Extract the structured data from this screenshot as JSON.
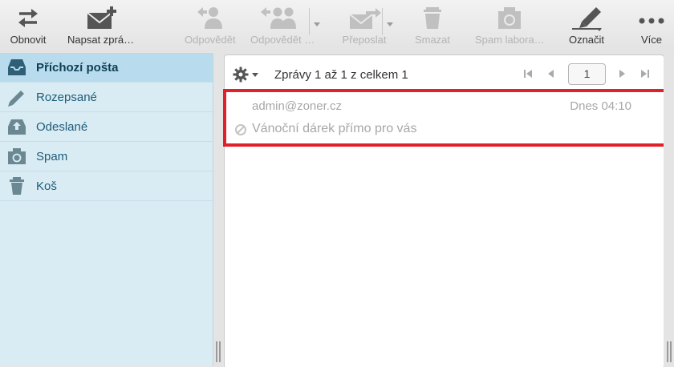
{
  "toolbar": {
    "refresh": "Obnovit",
    "compose": "Napsat zprá…",
    "reply": "Odpovědět",
    "reply_all": "Odpovědět …",
    "forward": "Přeposlat",
    "delete": "Smazat",
    "spam": "Spam labora…",
    "mark": "Označit",
    "more": "Více"
  },
  "sidebar": {
    "items": [
      {
        "label": "Příchozí pošta",
        "icon": "inbox-icon",
        "active": true
      },
      {
        "label": "Rozepsané",
        "icon": "pencil-icon"
      },
      {
        "label": "Odeslané",
        "icon": "sent-icon"
      },
      {
        "label": "Spam",
        "icon": "spam-icon"
      },
      {
        "label": "Koš",
        "icon": "trash-icon"
      }
    ]
  },
  "list": {
    "count_text": "Zprávy 1 až 1 z celkem 1",
    "page": "1"
  },
  "messages": [
    {
      "from": "admin@zoner.cz",
      "date": "Dnes 04:10",
      "subject": "Vánoční dárek přímo pro vás"
    }
  ],
  "colors": {
    "accent": "#1e5c78",
    "sidebar_bg": "#d9ecf4",
    "active_folder": "#b8dced",
    "highlight": "#e0202a"
  }
}
